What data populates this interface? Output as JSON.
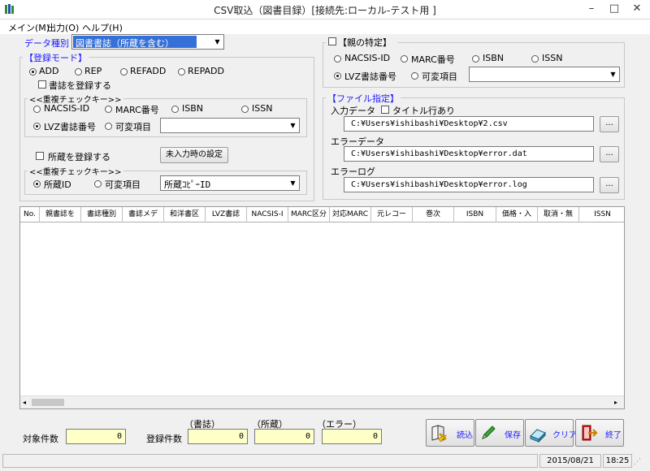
{
  "window": {
    "title": "CSV取込（図書目録）[接続先:ローカル-テスト用 ]",
    "minimize": "–",
    "maximize": "□",
    "close": "✕"
  },
  "menu": [
    "メイン(M)",
    "出力(O)",
    "ヘルプ(H)"
  ],
  "data_type": {
    "label": "データ種別",
    "value": "図書書誌（所蔵を含む）"
  },
  "reg_mode": {
    "title": "【登録モード】",
    "options": [
      "ADD",
      "REP",
      "REFADD",
      "REPADD"
    ],
    "selected": "ADD",
    "register_biblio": "書誌を登録する",
    "dup_title": "<<重複チェックキー>>",
    "dup_options": [
      "NACSIS-ID",
      "MARC番号",
      "ISBN",
      "ISSN",
      "LVZ書誌番号",
      "可変項目"
    ],
    "dup_selected": "LVZ書誌番号"
  },
  "holdings": {
    "register_holdings": "所蔵を登録する",
    "unentered_button": "未入力時の設定",
    "dup_title": "<<重複チェックキー>>",
    "options": [
      "所蔵ID",
      "可変項目"
    ],
    "selected": "所蔵ID",
    "combo_value": "所蔵ｺﾋﾟｰID"
  },
  "parent": {
    "title": "【親の特定】",
    "options": [
      "NACSIS-ID",
      "MARC番号",
      "ISBN",
      "ISSN",
      "LVZ書誌番号",
      "可変項目"
    ],
    "selected": "LVZ書誌番号"
  },
  "file": {
    "title": "【ファイル指定】",
    "input_label": "入力データ",
    "title_row": "タイトル行あり",
    "input_path": "C:¥Users¥ishibashi¥Desktop¥2.csv",
    "error_label": "エラーデータ",
    "error_path": "C:¥Users¥ishibashi¥Desktop¥error.dat",
    "log_label": "エラーログ",
    "log_path": "C:¥Users¥ishibashi¥Desktop¥error.log",
    "browse": "..."
  },
  "grid": {
    "columns": [
      "No.",
      "親書誌を",
      "書誌種別",
      "書誌メデ",
      "和洋書区",
      "LVZ書誌",
      "NACSIS-I",
      "MARC区分",
      "対応MARC",
      "元レコー",
      "巻次",
      "ISBN",
      "価格・入",
      "取消・無",
      "ISSN"
    ]
  },
  "counts": {
    "target_label": "対象件数",
    "target_value": "0",
    "reg_label": "登録件数",
    "biblio_label": "（書誌）",
    "biblio_value": "0",
    "holdings_label": "（所蔵）",
    "holdings_value": "0",
    "error_label": "（エラー）",
    "error_value": "0"
  },
  "actions": {
    "load": "読込",
    "save": "保存",
    "clear": "クリア",
    "exit": "終了"
  },
  "status": {
    "date": "2015/08/21",
    "time": "18:25"
  }
}
